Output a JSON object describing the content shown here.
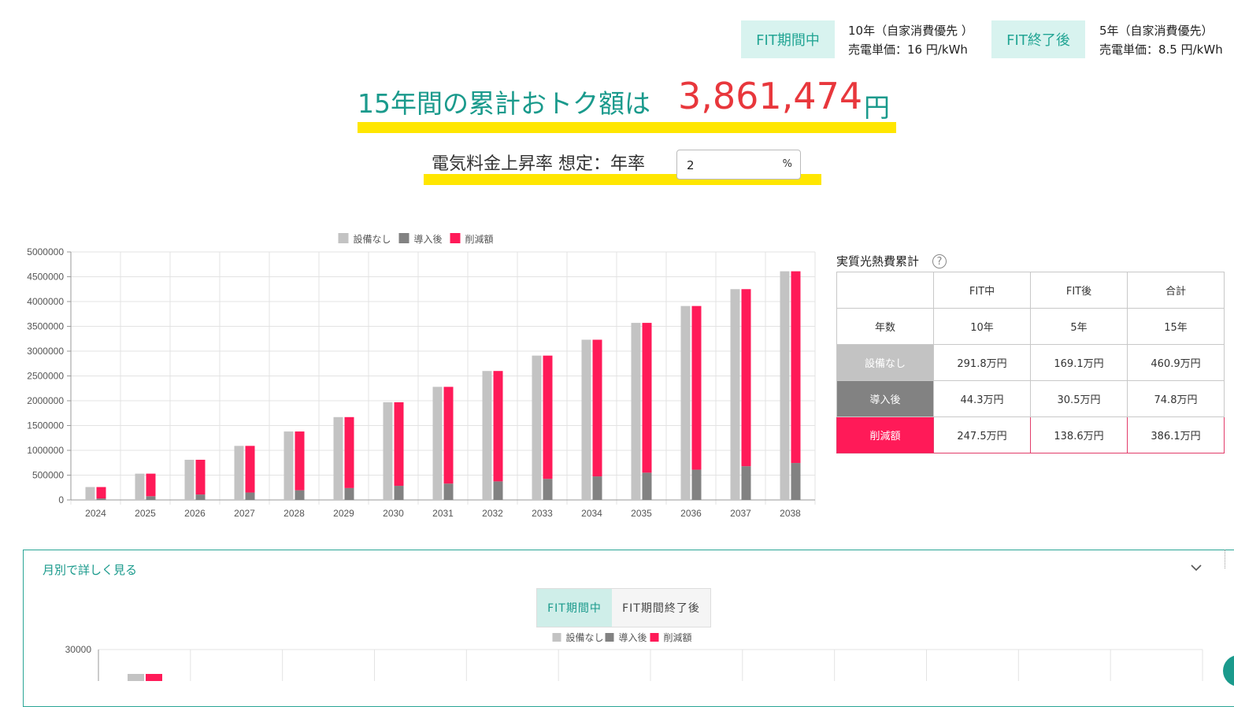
{
  "fit_header": {
    "during_badge": "FIT期間中",
    "during_years": "10年（自家消費優先 ）",
    "during_price": "売電単価：16 円/kWh",
    "after_badge": "FIT終了後",
    "after_years": "5年（自家消費優先）",
    "after_price": "売電単価：8.5 円/kWh"
  },
  "headline": {
    "label": "15年間の累計おトク額は",
    "amount": "3,861,474",
    "unit": "円"
  },
  "rate": {
    "label": "電気料金上昇率 想定：年率",
    "value": "2",
    "unit": "%"
  },
  "legend": [
    "設備なし",
    "導入後",
    "削減額"
  ],
  "colors": {
    "none": "#c3c3c3",
    "after": "#828282",
    "saving": "#ff1a58",
    "accent": "#1a9a8c",
    "highlight": "#ffe600",
    "amount": "#e8373c"
  },
  "chart_data": [
    {
      "type": "bar",
      "categories": [
        "2024",
        "2025",
        "2026",
        "2027",
        "2028",
        "2029",
        "2030",
        "2031",
        "2032",
        "2033",
        "2034",
        "2035",
        "2036",
        "2037",
        "2038"
      ],
      "ylim": [
        0,
        5000000
      ],
      "yticks": [
        "5000000",
        "4500000",
        "4000000",
        "3500000",
        "3000000",
        "2500000",
        "2000000",
        "1500000",
        "1000000",
        "500000",
        "0"
      ],
      "grid": true,
      "legend_position": "top",
      "series": [
        {
          "name": "設備なし",
          "values": [
            260000,
            530000,
            810000,
            1090000,
            1380000,
            1670000,
            1970000,
            2280000,
            2600000,
            2910000,
            3230000,
            3570000,
            3910000,
            4250000,
            4610000
          ],
          "stack": "a"
        },
        {
          "name": "導入後",
          "values": [
            30000,
            75000,
            110000,
            150000,
            195000,
            240000,
            285000,
            330000,
            375000,
            425000,
            475000,
            550000,
            610000,
            680000,
            745000
          ],
          "stack": "b"
        },
        {
          "name": "削減額",
          "values": [
            230000,
            455000,
            700000,
            940000,
            1185000,
            1430000,
            1685000,
            1950000,
            2225000,
            2485000,
            2755000,
            3020000,
            3300000,
            3570000,
            3865000
          ],
          "stack": "b"
        }
      ]
    },
    {
      "type": "bar",
      "categories": [],
      "ylim": [
        0,
        30000
      ],
      "yticks": [
        "30000"
      ],
      "grid": true,
      "legend_position": "top",
      "series": []
    }
  ],
  "summary_table": {
    "title": "実質光熱費累計",
    "help_icon": "question-circle-icon",
    "header": [
      "",
      "FIT中",
      "FIT後",
      "合計"
    ],
    "rows": [
      [
        "年数",
        "10年",
        "5年",
        "15年"
      ],
      [
        "設備なし",
        "291.8万円",
        "169.1万円",
        "460.9万円"
      ],
      [
        "導入後",
        "44.3万円",
        "30.5万円",
        "74.8万円"
      ],
      [
        "削減額",
        "247.5万円",
        "138.6万円",
        "386.1万円"
      ]
    ]
  },
  "monthly": {
    "title": "月別で詳しく見る",
    "chevron": "chevron-down-icon",
    "tabs": [
      "FIT期間中",
      "FIT期間終了後"
    ],
    "active_tab": "FIT期間中"
  }
}
